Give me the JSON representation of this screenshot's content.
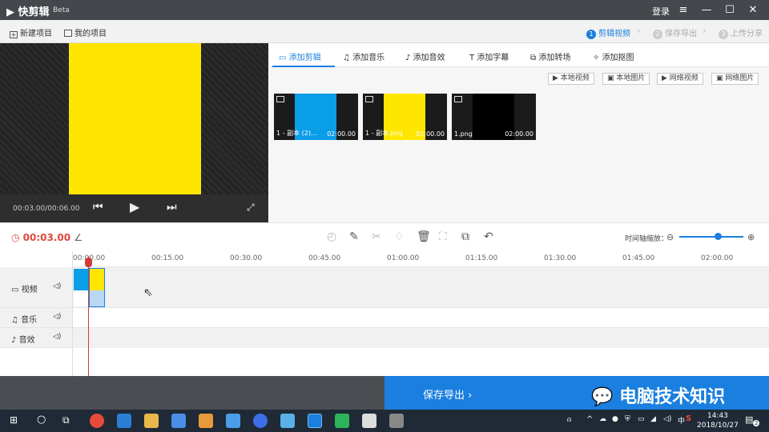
{
  "titlebar": {
    "app_name": "快剪辑",
    "beta": "Beta",
    "login": "登录",
    "menu_icon": "menu-icon",
    "min_icon": "minimize-icon",
    "max_icon": "maximize-icon",
    "close_icon": "close-icon"
  },
  "projectbar": {
    "new_project": "新建项目",
    "my_projects": "我的项目",
    "steps": [
      {
        "num": "1",
        "label": "剪辑视频"
      },
      {
        "num": "2",
        "label": "保存导出"
      },
      {
        "num": "3",
        "label": "上传分享"
      }
    ],
    "arrow": "›"
  },
  "preview": {
    "time": "00:03.00/00:06.00",
    "frame_color": "#ffe600"
  },
  "media_tabs": [
    "添加剪辑",
    "添加音乐",
    "添加音效",
    "添加字幕",
    "添加转场",
    "添加抠图"
  ],
  "source_buttons": [
    "本地视频",
    "本地图片",
    "网络视频",
    "网络图片"
  ],
  "clips": [
    {
      "name": "1 - 副本 (2)...",
      "duration": "02:00.00",
      "color": "#0a9de8"
    },
    {
      "name": "1 - 副本.png",
      "duration": "02:00.00",
      "color": "#ffe600"
    },
    {
      "name": "1.png",
      "duration": "02:00.00",
      "color": "#000000"
    }
  ],
  "toolbar": {
    "current_time": "00:03.00",
    "zoom_label": "时间轴缩放："
  },
  "timeline": {
    "ticks": [
      "00:00.00",
      "00:15.00",
      "00:30.00",
      "00:45.00",
      "01:00.00",
      "01:15.00",
      "01:30.00",
      "01:45.00",
      "02:00.00"
    ],
    "tracks": {
      "video": "视频",
      "music": "音乐",
      "sfx": "音效"
    }
  },
  "export": {
    "label": "保存导出 ›",
    "watermark": "电脑技术知识"
  },
  "taskbar": {
    "time": "14:43",
    "date": "2018/10/27",
    "notif_count": "2"
  },
  "colors": {
    "accent": "#1a7fdf",
    "playhead": "#d03a3a"
  }
}
